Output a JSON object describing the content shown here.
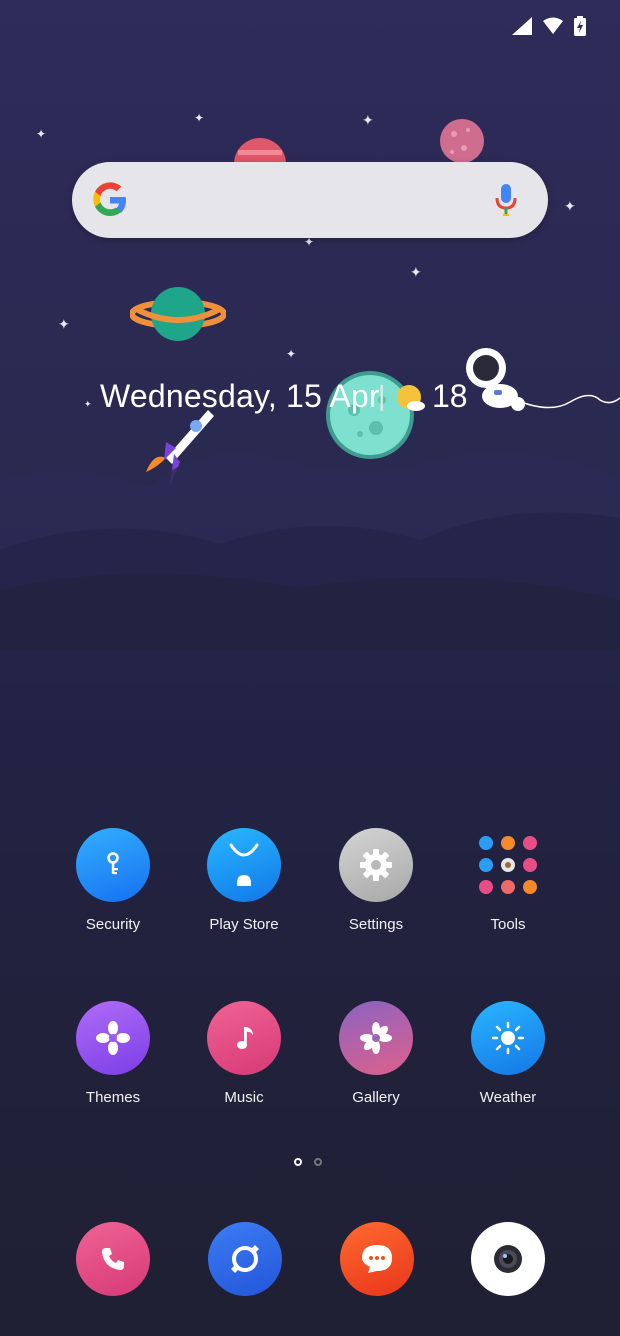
{
  "status_bar": {
    "icons": [
      "signal-icon",
      "wifi-icon",
      "battery-charging-icon"
    ]
  },
  "search_bar": {
    "logo": "google-g-icon",
    "mic": "mic-icon"
  },
  "date_widget": {
    "date_text": "Wednesday, 15 Apr",
    "separator": "|",
    "temperature": "18",
    "weather_icon": "partly-sunny-icon"
  },
  "apps": [
    {
      "label": "Security",
      "icon": "key-icon",
      "color": "#1e90ff"
    },
    {
      "label": "Play Store",
      "icon": "android-bag-icon",
      "color": "#1aa3f5"
    },
    {
      "label": "Settings",
      "icon": "gear-icon",
      "color": "#bdbdbd"
    },
    {
      "label": "Tools",
      "icon": "tools-grid-icon",
      "color": ""
    },
    {
      "label": "Themes",
      "icon": "flower-icon",
      "color": "#9b59f0"
    },
    {
      "label": "Music",
      "icon": "music-note-icon",
      "color": "#e84d86"
    },
    {
      "label": "Gallery",
      "icon": "gallery-flower-icon",
      "color": "#7a5fb0"
    },
    {
      "label": "Weather",
      "icon": "sun-icon",
      "color": "#1c8ef0"
    }
  ],
  "pager": {
    "pages": 2,
    "current": 1
  },
  "dock": [
    {
      "name": "phone",
      "icon": "phone-icon",
      "color": "#e84d86"
    },
    {
      "name": "browser",
      "icon": "compass-icon",
      "color": "#2f6ae8"
    },
    {
      "name": "messages",
      "icon": "message-icon",
      "color": "#f04e1e"
    },
    {
      "name": "camera",
      "icon": "camera-icon",
      "color": "#ffffff"
    }
  ]
}
